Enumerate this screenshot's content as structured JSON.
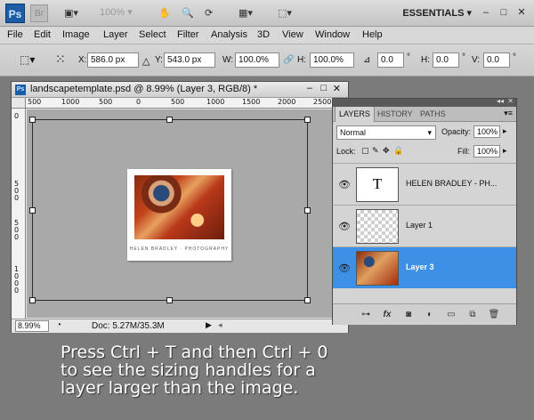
{
  "app": {
    "logo": "Ps",
    "bridge": "Br",
    "zoom_select": "100%",
    "workspace": "ESSENTIALS"
  },
  "menu": [
    "File",
    "Edit",
    "Image",
    "Layer",
    "Select",
    "Filter",
    "Analysis",
    "3D",
    "View",
    "Window",
    "Help"
  ],
  "options": {
    "x_label": "X:",
    "x_value": "586.0 px",
    "y_label": "Y:",
    "y_value": "543.0 px",
    "w_label": "W:",
    "w_value": "100.0%",
    "h_label": "H:",
    "h_value": "100.0%",
    "angle_value": "0.0",
    "hskew_label": "H:",
    "hskew_value": "0.0",
    "vskew_label": "V:",
    "vskew_value": "0.0",
    "degree": "°"
  },
  "document": {
    "title": "landscapetemplate.psd @ 8.99% (Layer 3, RGB/8) *",
    "zoom": "8.99%",
    "doc_size": "Doc: 5.27M/35.3M",
    "ruler_h": [
      "500",
      "1000",
      "500",
      "0",
      "500",
      "1000",
      "1500",
      "2000",
      "2500"
    ],
    "ruler_v": [
      "0",
      "5",
      "0",
      "0",
      "5",
      "0",
      "0",
      "5",
      "0",
      "0",
      "1",
      "0",
      "0",
      "0"
    ],
    "photo_caption": "HELEN BRADLEY · PHOTOGRAPHY"
  },
  "layers_panel": {
    "tabs": [
      "LAYERS",
      "HISTORY",
      "PATHS"
    ],
    "blend_mode": "Normal",
    "opacity_label": "Opacity:",
    "opacity_value": "100%",
    "lock_label": "Lock:",
    "fill_label": "Fill:",
    "fill_value": "100%",
    "layers": [
      {
        "name": "HELEN BRADLEY - PH...",
        "thumb": "T",
        "selected": false
      },
      {
        "name": "Layer 1",
        "thumb": "",
        "selected": false
      },
      {
        "name": "Layer 3",
        "thumb": "",
        "selected": true
      }
    ]
  },
  "caption": {
    "line1": "Press Ctrl + T and then Ctrl + 0",
    "line2": "to see the sizing handles for a",
    "line3": "layer larger than the image."
  },
  "colors": {
    "selected_layer": "#3d90e6",
    "ps_blue": "#1c5da5"
  }
}
